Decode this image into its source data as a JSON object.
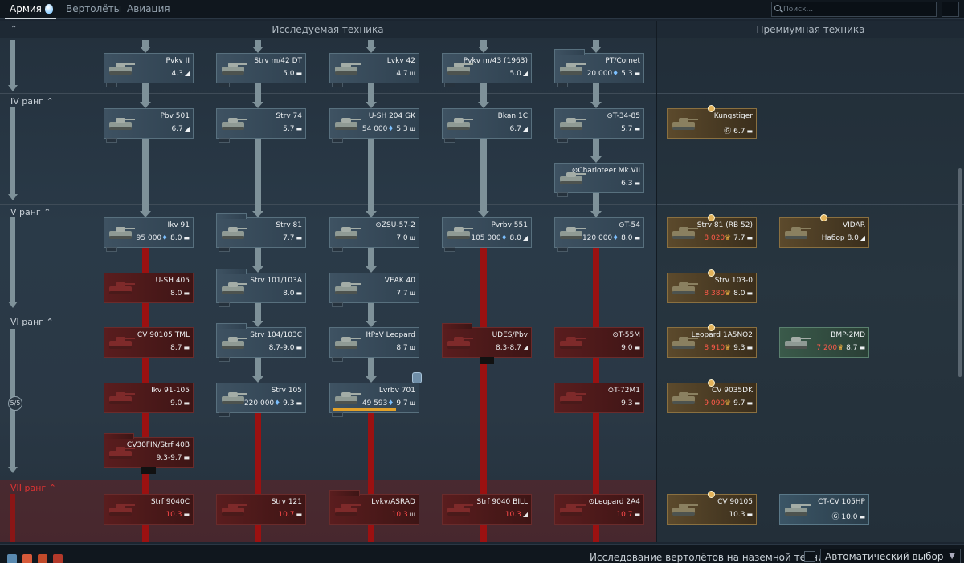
{
  "tabs": [
    {
      "label": "Армия",
      "active": true
    },
    {
      "label": "Вертолёты",
      "active": false
    },
    {
      "label": "Авиация",
      "active": false
    }
  ],
  "search": {
    "placeholder": "Поиск..."
  },
  "headers": {
    "researched": "Исследуемая техника",
    "premium": "Премиумная техника"
  },
  "ranks": [
    {
      "label": "IV ранг"
    },
    {
      "label": "V ранг"
    },
    {
      "label": "VI ранг"
    },
    {
      "label": "VII ранг"
    }
  ],
  "rank_progress": "5/5",
  "vehicles": [
    {
      "name": "Pvkv II",
      "br": "4.3",
      "cost": "",
      "state": "researched",
      "type": "td"
    },
    {
      "name": "Strv m/42 DT",
      "br": "5.0",
      "cost": "",
      "state": "researched",
      "type": "mt"
    },
    {
      "name": "Lvkv 42",
      "br": "4.7",
      "cost": "",
      "state": "researched",
      "type": "spaa"
    },
    {
      "name": "Pvkv m/43 (1963)",
      "br": "5.0",
      "cost": "",
      "state": "researched",
      "type": "td"
    },
    {
      "name": "PT/Comet",
      "br": "5.3",
      "cost": "20 000",
      "state": "researched",
      "type": "ht"
    },
    {
      "name": "Pbv 501",
      "br": "6.7",
      "cost": "",
      "state": "researched",
      "type": "td"
    },
    {
      "name": "Strv 74",
      "br": "5.7",
      "cost": "",
      "state": "researched",
      "type": "mt"
    },
    {
      "name": "U-SH 204 GK",
      "br": "5.3",
      "cost": "54 000",
      "state": "researched",
      "type": "spaa"
    },
    {
      "name": "Bkan 1C",
      "br": "6.7",
      "cost": "",
      "state": "researched",
      "type": "td"
    },
    {
      "name": "T-34-85",
      "br": "5.7",
      "cost": "",
      "state": "researched",
      "type": "mt"
    },
    {
      "name": "Charioteer Mk.VII",
      "br": "6.3",
      "cost": "",
      "state": "researched",
      "type": "mt"
    },
    {
      "name": "Ikv 91",
      "br": "8.0",
      "cost": "95 000",
      "state": "researched",
      "type": "lt"
    },
    {
      "name": "Strv 81",
      "br": "7.7",
      "cost": "",
      "state": "researched",
      "type": "mt"
    },
    {
      "name": "ZSU-57-2",
      "br": "7.0",
      "cost": "",
      "state": "researched",
      "type": "spaa"
    },
    {
      "name": "Pvrbv 551",
      "br": "8.0",
      "cost": "105 000",
      "state": "researched",
      "type": "td"
    },
    {
      "name": "T-54",
      "br": "8.0",
      "cost": "120 000",
      "state": "researched",
      "type": "lt"
    },
    {
      "name": "U-SH 405",
      "br": "8.0",
      "cost": "",
      "state": "locked",
      "type": "lt"
    },
    {
      "name": "Strv 101/103A",
      "br": "8.0",
      "cost": "",
      "state": "researched",
      "type": "mt"
    },
    {
      "name": "VEAK 40",
      "br": "7.7",
      "cost": "",
      "state": "researched",
      "type": "spaa"
    },
    {
      "name": "CV 90105 TML",
      "br": "8.7",
      "cost": "",
      "state": "locked",
      "type": "lt"
    },
    {
      "name": "Strv 104/103C",
      "br": "8.7-9.0",
      "cost": "",
      "state": "researched",
      "type": "mt"
    },
    {
      "name": "ItPsV Leopard",
      "br": "8.7",
      "cost": "",
      "state": "researched",
      "type": "spaa"
    },
    {
      "name": "UDES/Pbv",
      "br": "8.3-8.7",
      "cost": "",
      "state": "locked",
      "type": "td"
    },
    {
      "name": "T-55M",
      "br": "9.0",
      "cost": "",
      "state": "locked",
      "type": "lt"
    },
    {
      "name": "Ikv 91-105",
      "br": "9.0",
      "cost": "",
      "state": "locked",
      "type": "lt"
    },
    {
      "name": "Strv 105",
      "br": "9.3",
      "cost": "220 000",
      "state": "researched",
      "type": "lt"
    },
    {
      "name": "Lvrbv 701",
      "br": "9.7",
      "cost": "49 593",
      "state": "researching",
      "type": "spaa",
      "progress": 0.75
    },
    {
      "name": "T-72M1",
      "br": "9.3",
      "cost": "",
      "state": "locked",
      "type": "lt"
    },
    {
      "name": "CV30FIN/Strf 40B",
      "br": "9.3-9.7",
      "cost": "",
      "state": "locked",
      "type": "lt"
    },
    {
      "name": "Strf 9040C",
      "br": "10.3",
      "cost": "",
      "state": "locked",
      "type": "lt"
    },
    {
      "name": "Strv 121",
      "br": "10.7",
      "cost": "",
      "state": "locked",
      "type": "mt"
    },
    {
      "name": "Lvkv/ASRAD",
      "br": "10.3",
      "cost": "",
      "state": "locked",
      "type": "spaa"
    },
    {
      "name": "Strf 9040 BILL",
      "br": "10.3",
      "cost": "",
      "state": "locked",
      "type": "td"
    },
    {
      "name": "Leopard 2A4",
      "br": "10.7",
      "cost": "",
      "state": "locked",
      "type": "mt"
    }
  ],
  "premium": [
    {
      "name": "Kungstiger",
      "br": "6.7",
      "cost": "",
      "type": "ht"
    },
    {
      "name": "Strv 81 (RB 52)",
      "br": "7.7",
      "cost": "8 020",
      "type": "mt"
    },
    {
      "name": "VIDAR",
      "br": "8.0",
      "cost": "Набор",
      "type": "td"
    },
    {
      "name": "Strv 103-0",
      "br": "8.0",
      "cost": "8 380",
      "type": "mt"
    },
    {
      "name": "Leopard 1A5NO2",
      "br": "9.3",
      "cost": "8 910",
      "type": "mt"
    },
    {
      "name": "BMP-2MD",
      "br": "8.7",
      "cost": "7 200",
      "type": "lt"
    },
    {
      "name": "CV 9035DK",
      "br": "9.7",
      "cost": "9 090",
      "type": "lt"
    },
    {
      "name": "CV 90105",
      "br": "10.3",
      "cost": "",
      "type": "lt"
    },
    {
      "name": "CT-CV 105HP",
      "br": "10.0",
      "cost": "",
      "type": "lt"
    }
  ],
  "bottom": {
    "heli_label": "Исследование вертолётов на наземной технике",
    "auto_select": "Автоматический выбор"
  },
  "colors": {
    "researched": "#3e5262",
    "locked": "#5a1d1e",
    "premium": "#5c4a2c",
    "connector": "#7e9199",
    "locked_connector": "#9b1111"
  }
}
